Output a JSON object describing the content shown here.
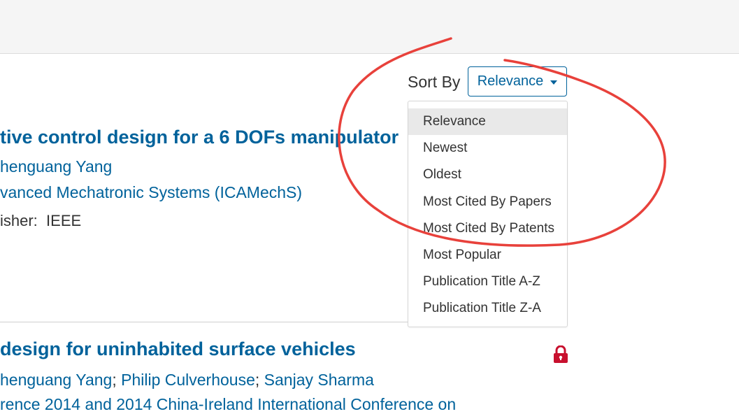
{
  "sort": {
    "label": "Sort By",
    "selected": "Relevance",
    "options": [
      "Relevance",
      "Newest",
      "Oldest",
      "Most Cited By Papers",
      "Most Cited By Patents",
      "Most Popular",
      "Publication Title A-Z",
      "Publication Title Z-A"
    ]
  },
  "results": [
    {
      "title": "tive control design for a 6 DOFs manipulator",
      "authors": "henguang Yang",
      "venue": "vanced Mechatronic Systems (ICAMechS)",
      "publisher_label": "isher:",
      "publisher": "IEEE"
    },
    {
      "title": "design for uninhabited surface vehicles",
      "authors": [
        "henguang Yang",
        "Philip Culverhouse",
        "Sanjay Sharma"
      ],
      "venue": "rence 2014 and 2014 China-Ireland International Conference on"
    }
  ],
  "icons": {
    "lock": "lock-icon"
  },
  "colors": {
    "link": "#00629b",
    "lock": "#c8102e",
    "annotation": "#e8413b",
    "top_band": "#f5f5f5",
    "active_option": "#e9e9e9"
  }
}
